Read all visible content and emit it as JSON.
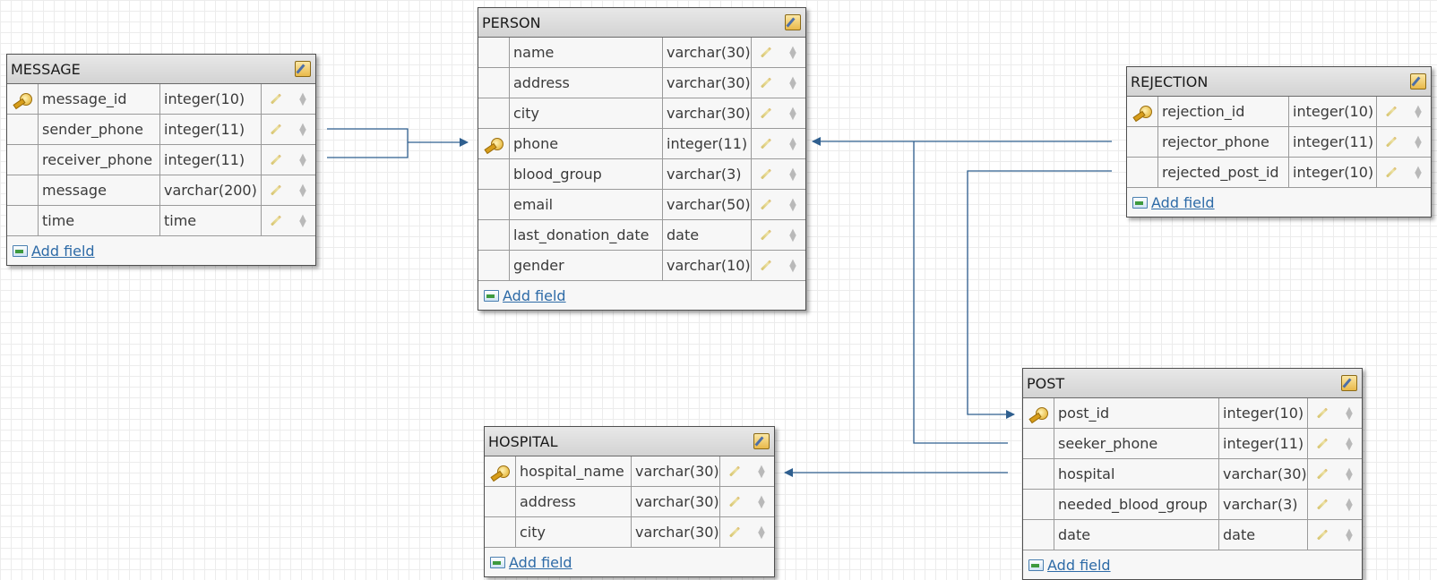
{
  "colors": {
    "connector": "#2f5f8f",
    "header_bg": "#d9d9d9",
    "grid": "#ececec"
  },
  "icons": {
    "primary_key": "key-icon",
    "edit_field": "pencil-icon",
    "reorder": "move-icon",
    "add_field": "add-field-icon",
    "edit_table": "edit-table-icon"
  },
  "tables": {
    "message": {
      "title": "MESSAGE",
      "add_field": "Add field",
      "fields": [
        {
          "name": "message_id",
          "type": "integer(10)",
          "pk": true
        },
        {
          "name": "sender_phone",
          "type": "integer(11)",
          "pk": false
        },
        {
          "name": "receiver_phone",
          "type": "integer(11)",
          "pk": false
        },
        {
          "name": "message",
          "type": "varchar(200)",
          "pk": false
        },
        {
          "name": "time",
          "type": "time",
          "pk": false
        }
      ]
    },
    "person": {
      "title": "PERSON",
      "add_field": "Add field",
      "fields": [
        {
          "name": "name",
          "type": "varchar(30)",
          "pk": false
        },
        {
          "name": "address",
          "type": "varchar(30)",
          "pk": false
        },
        {
          "name": "city",
          "type": "varchar(30)",
          "pk": false
        },
        {
          "name": "phone",
          "type": "integer(11)",
          "pk": true
        },
        {
          "name": "blood_group",
          "type": "varchar(3)",
          "pk": false
        },
        {
          "name": "email",
          "type": "varchar(50)",
          "pk": false
        },
        {
          "name": "last_donation_date",
          "type": "date",
          "pk": false
        },
        {
          "name": "gender",
          "type": "varchar(10)",
          "pk": false
        }
      ]
    },
    "rejection": {
      "title": "REJECTION",
      "add_field": "Add field",
      "fields": [
        {
          "name": "rejection_id",
          "type": "integer(10)",
          "pk": true
        },
        {
          "name": "rejector_phone",
          "type": "integer(11)",
          "pk": false
        },
        {
          "name": "rejected_post_id",
          "type": "integer(10)",
          "pk": false
        }
      ]
    },
    "hospital": {
      "title": "HOSPITAL",
      "add_field": "Add field",
      "fields": [
        {
          "name": "hospital_name",
          "type": "varchar(30)",
          "pk": true
        },
        {
          "name": "address",
          "type": "varchar(30)",
          "pk": false
        },
        {
          "name": "city",
          "type": "varchar(30)",
          "pk": false
        }
      ]
    },
    "post": {
      "title": "POST",
      "add_field": "Add field",
      "fields": [
        {
          "name": "post_id",
          "type": "integer(10)",
          "pk": true
        },
        {
          "name": "seeker_phone",
          "type": "integer(11)",
          "pk": false
        },
        {
          "name": "hospital",
          "type": "varchar(30)",
          "pk": false
        },
        {
          "name": "needed_blood_group",
          "type": "varchar(3)",
          "pk": false
        },
        {
          "name": "date",
          "type": "date",
          "pk": false
        }
      ]
    }
  },
  "relations": [
    {
      "from": "message.sender_phone",
      "to": "person.phone"
    },
    {
      "from": "message.receiver_phone",
      "to": "person.phone"
    },
    {
      "from": "rejection.rejector_phone",
      "to": "person.phone"
    },
    {
      "from": "post.seeker_phone",
      "to": "person.phone"
    },
    {
      "from": "rejection.rejected_post_id",
      "to": "post.post_id"
    },
    {
      "from": "post.hospital",
      "to": "hospital.hospital_name"
    }
  ]
}
